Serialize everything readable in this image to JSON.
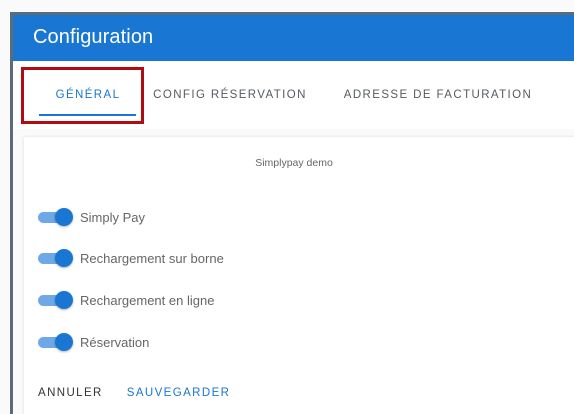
{
  "header": {
    "title": "Configuration"
  },
  "tabs": [
    {
      "label": "GÉNÉRAL",
      "active": true
    },
    {
      "label": "CONFIG RÉSERVATION",
      "active": false
    },
    {
      "label": "ADRESSE DE FACTURATION",
      "active": false
    }
  ],
  "card": {
    "title": "Simplypay demo",
    "toggles": [
      {
        "label": "Simply Pay",
        "on": true
      },
      {
        "label": "Rechargement sur borne",
        "on": true
      },
      {
        "label": "Rechargement en ligne",
        "on": true
      },
      {
        "label": "Réservation",
        "on": true
      }
    ]
  },
  "actions": {
    "cancel_label": "ANNULER",
    "save_label": "SAUVEGARDER"
  },
  "colors": {
    "primary": "#1976d2",
    "highlight": "#b00d13",
    "toggle_track": "#6ea8e6"
  }
}
